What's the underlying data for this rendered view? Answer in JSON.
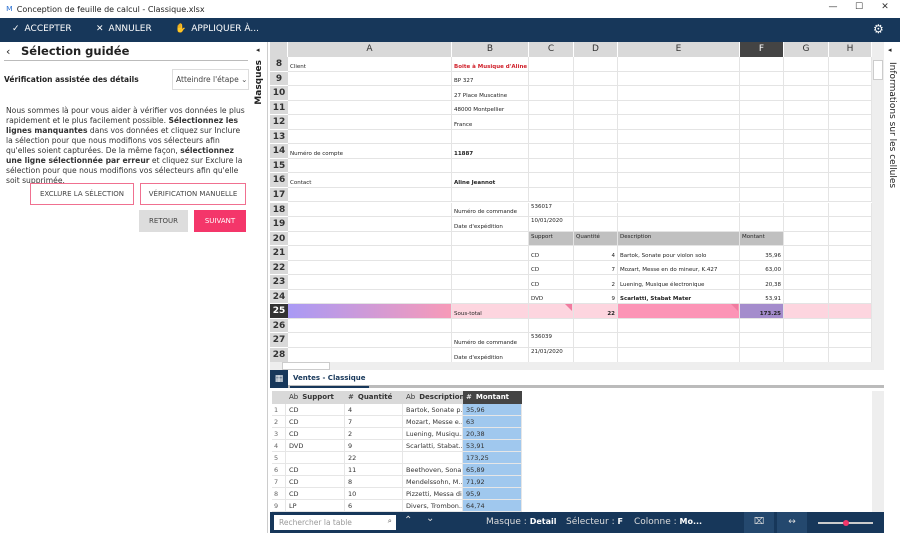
{
  "window": {
    "title": "Conception de feuille de calcul - Classique.xlsx"
  },
  "toolbar": {
    "accept": "ACCEPTER",
    "cancel": "ANNULER",
    "apply": "APPLIQUER À..."
  },
  "left_panel": {
    "title": "Sélection guidée",
    "subtitle": "Vérification assistée des détails",
    "step_dropdown": "Atteindre l'étape",
    "paragraph": [
      {
        "t": "Nous sommes là pour vous aider à vérifier vos données le plus rapidement et le plus facilement possible. ",
        "b": false
      },
      {
        "t": "Sélectionnez les lignes manquantes",
        "b": true
      },
      {
        "t": " dans vos données et cliquez sur Inclure la sélection pour que nous modifions vos sélecteurs afin qu'elles soient capturées. De la même façon, ",
        "b": false
      },
      {
        "t": "sélectionnez une ligne sélectionnée par erreur",
        "b": true
      },
      {
        "t": " et cliquez sur Exclure la sélection pour que nous modifions vos sélecteurs afin qu'elle soit supprimée.",
        "b": false
      }
    ],
    "exclude_btn": "EXCLURE LA SÉLECTION",
    "manual_btn": "VÉRIFICATION MANUELLE",
    "back_btn": "RETOUR",
    "next_btn": "SUIVANT"
  },
  "side_tabs": {
    "masks": "Masques",
    "cell_info": "Informations sur les cellules"
  },
  "sheet": {
    "columns": [
      "A",
      "B",
      "C",
      "D",
      "E",
      "F",
      "G",
      "H"
    ],
    "selected_column": "F",
    "selected_row": "25",
    "rows": [
      {
        "n": "8",
        "A": "Client",
        "B": "Boite à Musique d'Aline"
      },
      {
        "n": "9",
        "B": "BP 327"
      },
      {
        "n": "10",
        "B": "27 Place Muscatine"
      },
      {
        "n": "11",
        "B": "48000 Montpellier"
      },
      {
        "n": "12",
        "B": "France"
      },
      {
        "n": "13"
      },
      {
        "n": "14",
        "A": "Numéro de compte",
        "B": "11887"
      },
      {
        "n": "15"
      },
      {
        "n": "16",
        "A": "Contact",
        "B": "Aline Jeannot"
      },
      {
        "n": "17"
      },
      {
        "n": "18",
        "B": "Numéro de commande",
        "C": "536017"
      },
      {
        "n": "19",
        "B": "Date d'expédition",
        "C": "10/01/2020"
      },
      {
        "n": "20",
        "C": "Support",
        "D": "Quantité",
        "E": "Description",
        "F": "Montant"
      },
      {
        "n": "21",
        "C": "CD",
        "D": "4",
        "E": "Bartok, Sonate pour violon solo",
        "F": "35,96"
      },
      {
        "n": "22",
        "C": "CD",
        "D": "7",
        "E": "Mozart, Messe en do mineur, K.427",
        "F": "63,00"
      },
      {
        "n": "23",
        "C": "CD",
        "D": "2",
        "E": "Luening, Musique électronique",
        "F": "20,38"
      },
      {
        "n": "24",
        "C": "DVD",
        "D": "9",
        "E": "Scarlatti, Stabat Mater",
        "F": "53,91"
      },
      {
        "n": "25",
        "B": "Sous-total",
        "D": "22",
        "F": "173.25"
      },
      {
        "n": "26"
      },
      {
        "n": "27",
        "B": "Numéro de commande",
        "C": "536039"
      },
      {
        "n": "28",
        "B": "Date d'expédition",
        "C": "21/01/2020"
      }
    ]
  },
  "table_tab": "Ventes - Classique",
  "table": {
    "headers": [
      {
        "type": "Ab",
        "label": "Support"
      },
      {
        "type": "#",
        "label": "Quantité"
      },
      {
        "type": "Ab",
        "label": "Description"
      },
      {
        "type": "#",
        "label": "Montant"
      }
    ],
    "rows": [
      [
        "1",
        "CD",
        "4",
        "Bartok, Sonate p...",
        "35,96"
      ],
      [
        "2",
        "CD",
        "7",
        "Mozart, Messe e...",
        "63"
      ],
      [
        "3",
        "CD",
        "2",
        "Luening, Musiqu...",
        "20,38"
      ],
      [
        "4",
        "DVD",
        "9",
        "Scarlatti, Stabat...",
        "53,91"
      ],
      [
        "5",
        "",
        "22",
        "",
        "173,25"
      ],
      [
        "6",
        "CD",
        "11",
        "Beethoven, Sona...",
        "65,89"
      ],
      [
        "7",
        "CD",
        "8",
        "Mendelssohn, M...",
        "71,92"
      ],
      [
        "8",
        "CD",
        "10",
        "Pizzetti, Messa di...",
        "95,9"
      ],
      [
        "9",
        "LP",
        "6",
        "Divers, Trombon...",
        "64,74"
      ]
    ]
  },
  "status": {
    "search_placeholder": "Rechercher la table",
    "mask_label": "Masque :",
    "mask_value": "Detail",
    "selector_label": "Sélecteur :",
    "selector_value": "F",
    "column_label": "Colonne :",
    "column_value": "Mo...",
    "zoom_level": 0.5
  },
  "colors": {
    "navy": "#17375a",
    "accent": "#f4366a",
    "selected_header": "#444444",
    "highlight": "#a0c8ee"
  }
}
